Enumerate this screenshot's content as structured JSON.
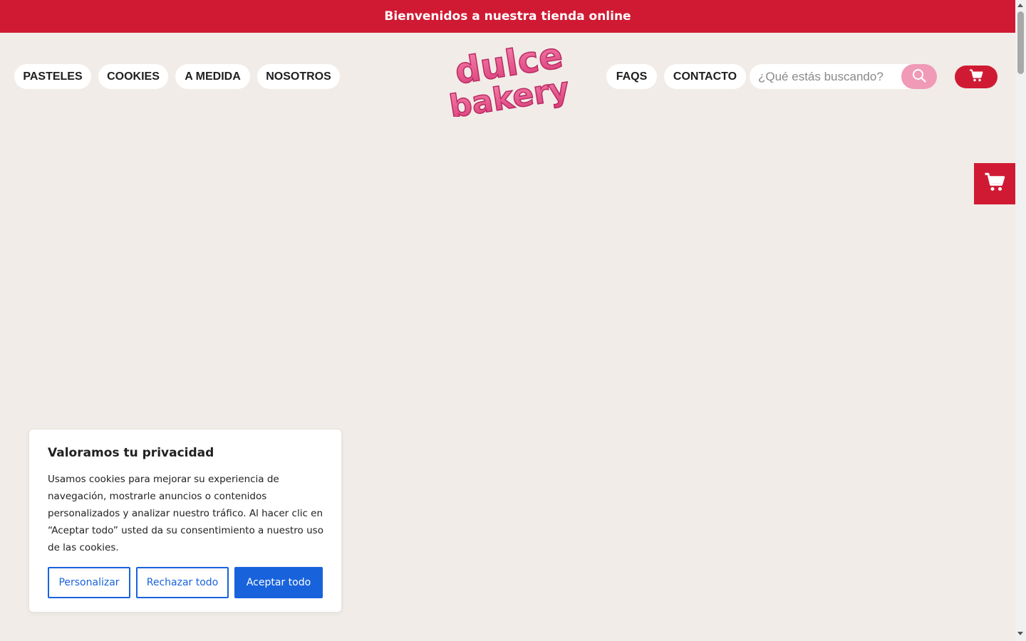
{
  "announcement": "Bienvenidos a nuestra tienda online",
  "nav_left": [
    "PASTELES",
    "COOKIES",
    "A MEDIDA",
    "NOSOTROS"
  ],
  "nav_right": [
    "FAQS",
    "CONTACTO"
  ],
  "logo": {
    "line1": "dulce",
    "line2": "bakery"
  },
  "search": {
    "placeholder": "¿Qué estás buscando?",
    "value": ""
  },
  "icons": {
    "search": "search-icon",
    "cart": "cart-icon",
    "side_cart": "cart-icon"
  },
  "cookie_banner": {
    "title": "Valoramos tu privacidad",
    "body": "Usamos cookies para mejorar su experiencia de navegación, mostrarle anuncios o contenidos personalizados y analizar nuestro tráfico. Al hacer clic en “Aceptar todo” usted da su consentimiento a nuestro uso de las cookies.",
    "customize_label": "Personalizar",
    "reject_label": "Rechazar todo",
    "accept_label": "Aceptar todo"
  },
  "colors": {
    "brand_red": "#d01a33",
    "search_pink": "#f09ab7",
    "logo_pink": "#ee5d92",
    "background": "#f1ece7",
    "cookie_blue": "#1863dc"
  }
}
